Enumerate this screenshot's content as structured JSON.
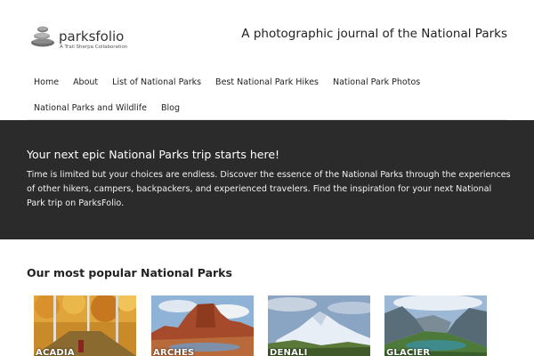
{
  "header": {
    "logo_name": "parksfolio",
    "logo_tagline": "A Trail Sherpa Collaboration",
    "tagline": "A photographic journal of the National Parks"
  },
  "nav": {
    "row1": [
      "Home",
      "About",
      "List of National Parks",
      "Best National Park Hikes",
      "National Park Photos"
    ],
    "row2": [
      "National Parks and Wildlife",
      "Blog"
    ]
  },
  "hero": {
    "title": "Your next epic National Parks trip starts here!",
    "text": "Time is limited but your choices are endless. Discover the essence of the National Parks through the experiences of other hikers, campers, backpackers, and experienced travelers. Find the inspiration for your next National Park trip on ParksFolio.",
    "background": "#2b2b2b"
  },
  "popular": {
    "title": "Our most popular National Parks",
    "parks": [
      {
        "label": "ACADIA",
        "image": "autumn-forest-trail"
      },
      {
        "label": "ARCHES",
        "image": "red-rock-formation"
      },
      {
        "label": "DENALI",
        "image": "snowy-mountain"
      },
      {
        "label": "GLACIER",
        "image": "mountain-valley-lake"
      }
    ]
  }
}
